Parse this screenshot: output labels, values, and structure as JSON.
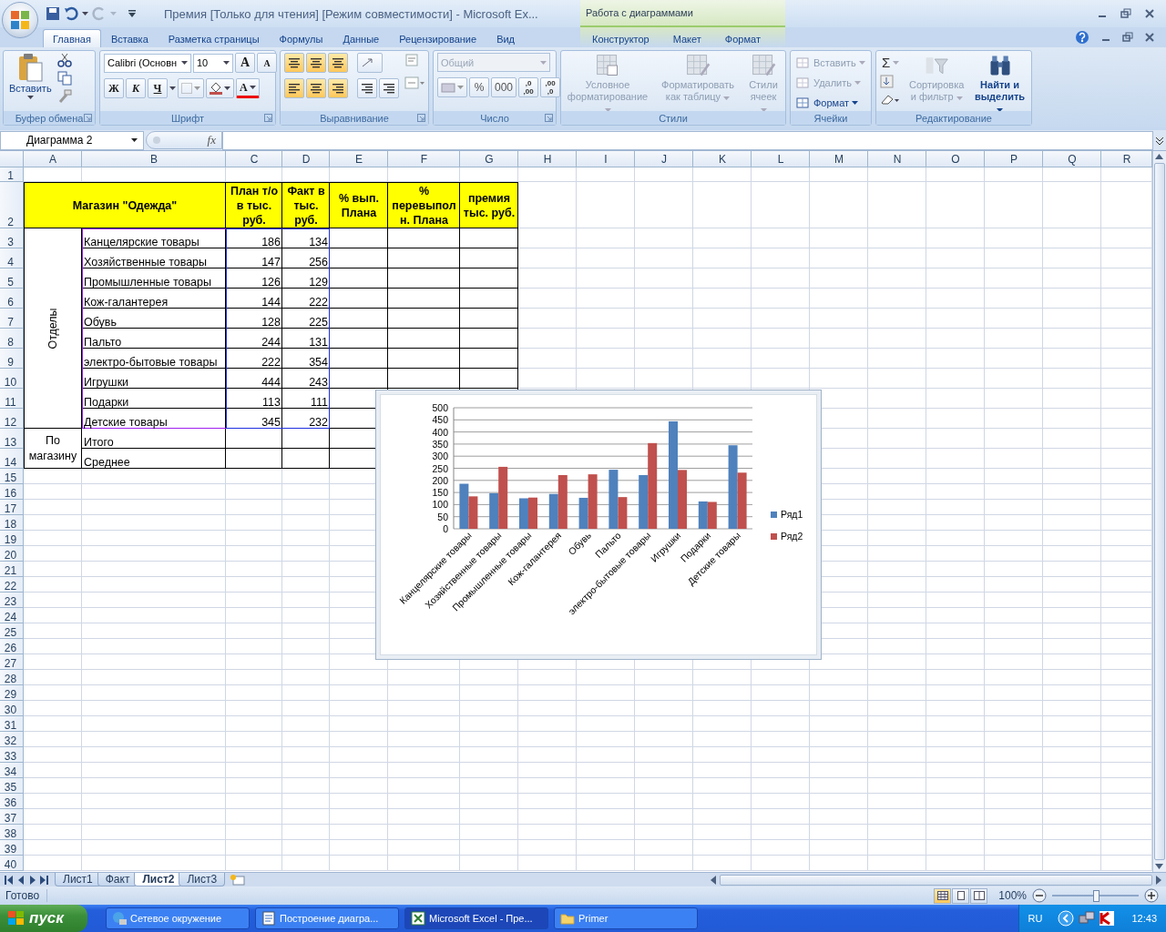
{
  "window": {
    "title": "Премия  [Только для чтения]  [Режим совместимости] - Microsoft Ex...",
    "context_label": "Работа с диаграммами"
  },
  "ribbon_tabs": [
    {
      "label": "Главная",
      "selected": true
    },
    {
      "label": "Вставка",
      "selected": false
    },
    {
      "label": "Разметка страницы",
      "selected": false
    },
    {
      "label": "Формулы",
      "selected": false
    },
    {
      "label": "Данные",
      "selected": false
    },
    {
      "label": "Рецензирование",
      "selected": false
    },
    {
      "label": "Вид",
      "selected": false
    }
  ],
  "context_tabs": [
    {
      "label": "Конструктор",
      "selected": false
    },
    {
      "label": "Макет",
      "selected": false
    },
    {
      "label": "Формат",
      "selected": false
    }
  ],
  "ribbon_groups": [
    {
      "kind": "clipboard",
      "title": "Буфер обмена",
      "launcher": true,
      "paste_label": "Вставить"
    },
    {
      "kind": "font",
      "title": "Шрифт",
      "launcher": true,
      "font_name": "Calibri (Основн",
      "font_size": "10",
      "size_buttons": [
        "A",
        "A"
      ],
      "style_buttons": [
        "Ж",
        "К",
        "Ч"
      ],
      "color_label": "A"
    },
    {
      "kind": "alignment",
      "title": "Выравнивание",
      "launcher": true
    },
    {
      "kind": "number",
      "title": "Число",
      "launcher": true,
      "format": "Общий",
      "format_disabled": true,
      "symbols": [
        "%",
        "000"
      ],
      "decimal_buttons": [
        [
          ",0",
          ",00"
        ],
        [
          ",00",
          ",0"
        ]
      ]
    },
    {
      "kind": "styles",
      "title": "Стили",
      "launcher": false,
      "buttons": [
        {
          "label": "Условное форматирование",
          "disabled": true
        },
        {
          "label": "Форматировать как таблицу",
          "disabled": true
        },
        {
          "label": "Стили ячеек",
          "disabled": true
        }
      ]
    },
    {
      "kind": "cells",
      "title": "Ячейки",
      "launcher": false,
      "buttons": [
        {
          "label": "Вставить",
          "disabled": true
        },
        {
          "label": "Удалить",
          "disabled": true
        },
        {
          "label": "Формат",
          "disabled": false
        }
      ]
    },
    {
      "kind": "editing",
      "title": "Редактирование",
      "launcher": false,
      "sum_label": "Σ",
      "buttons": [
        {
          "label": "Сортировка и фильтр",
          "disabled": true
        },
        {
          "label": "Найти и выделить",
          "disabled": false
        }
      ]
    }
  ],
  "formula_bar": {
    "name_box": "Диаграмма 2",
    "fx_label": "fx"
  },
  "sheet": {
    "columns": [
      "A",
      "B",
      "C",
      "D",
      "E",
      "F",
      "G",
      "H",
      "I",
      "J",
      "K",
      "L",
      "M",
      "N",
      "O",
      "P",
      "Q",
      "R"
    ],
    "row_numbers": [
      "1",
      "2",
      "3",
      "4",
      "5",
      "6",
      "7",
      "8",
      "9",
      "10",
      "11",
      "12",
      "13",
      "14",
      "15",
      "16",
      "17",
      "18",
      "19",
      "20",
      "21",
      "22",
      "23",
      "24",
      "25",
      "26",
      "27",
      "28",
      "29",
      "30",
      "31",
      "32",
      "33",
      "34",
      "35",
      "36",
      "37",
      "38",
      "39",
      "40"
    ],
    "chart_source_highlight": true,
    "title": "Магазин \"Одежда\"",
    "headers": [
      "План т/о в тыс. руб.",
      "Факт в тыс. руб.",
      "% вып. Плана",
      "% перевыполн. Плана",
      "премия тыс. руб."
    ],
    "group_label": "Отделы",
    "items": [
      {
        "name": "Канцелярские товары",
        "plan": "186",
        "fact": "134"
      },
      {
        "name": "Хозяйственные товары",
        "plan": "147",
        "fact": "256"
      },
      {
        "name": "Промышленные товары",
        "plan": "126",
        "fact": "129"
      },
      {
        "name": "Кож-галантерея",
        "plan": "144",
        "fact": "222"
      },
      {
        "name": "Обувь",
        "plan": "128",
        "fact": "225"
      },
      {
        "name": "Пальто",
        "plan": "244",
        "fact": "131"
      },
      {
        "name": "электро-бытовые товары",
        "plan": "222",
        "fact": "354"
      },
      {
        "name": "Игрушки",
        "plan": "444",
        "fact": "243"
      },
      {
        "name": "Подарки",
        "plan": "113",
        "fact": "111"
      },
      {
        "name": "Детские товары",
        "plan": "345",
        "fact": "232"
      }
    ],
    "summary_label": "По магазину",
    "summary_rows": [
      "Итого",
      "Среднее"
    ]
  },
  "chart": {
    "chart_data": {
      "type": "bar",
      "categories": [
        "Канцелярские товары",
        "Хозяйственные товары",
        "Промышленные товары",
        "Кож-галантерея",
        "Обувь",
        "Пальто",
        "электро-бытовые товары",
        "Игрушки",
        "Подарки",
        "Детские товары"
      ],
      "series": [
        {
          "name": "Ряд1",
          "color": "#4f81bd",
          "values": [
            186,
            147,
            126,
            144,
            128,
            244,
            222,
            444,
            113,
            345
          ]
        },
        {
          "name": "Ряд2",
          "color": "#c0504d",
          "values": [
            134,
            256,
            129,
            222,
            225,
            131,
            354,
            243,
            111,
            232
          ]
        }
      ],
      "grid": true,
      "legend": true,
      "ylim": [
        0,
        500
      ],
      "yticks": [
        0,
        50,
        100,
        150,
        200,
        250,
        300,
        350,
        400,
        450,
        500
      ]
    }
  },
  "sheet_tabs": [
    {
      "label": "Лист1",
      "selected": false
    },
    {
      "label": "Факт",
      "selected": false
    },
    {
      "label": "Лист2",
      "selected": true
    },
    {
      "label": "Лист3",
      "selected": false
    }
  ],
  "status_bar": {
    "text": "Готово",
    "views": [
      {
        "kind": "normal",
        "selected": true
      },
      {
        "kind": "layout",
        "selected": false
      },
      {
        "kind": "pagebreak",
        "selected": false
      }
    ],
    "zoom": "100%",
    "zoom_slider": {
      "level": 0.5
    }
  },
  "taskbar": {
    "start": "пуск",
    "tasks": [
      {
        "kind": "network",
        "label": "Сетевое окружение",
        "selected": false
      },
      {
        "kind": "word",
        "label": "Построение диагра...",
        "selected": false
      },
      {
        "kind": "excel",
        "label": "Microsoft Excel - Пре...",
        "selected": true
      },
      {
        "kind": "folder",
        "label": "Primer",
        "selected": false
      }
    ],
    "language": "RU",
    "time": "12:43"
  }
}
